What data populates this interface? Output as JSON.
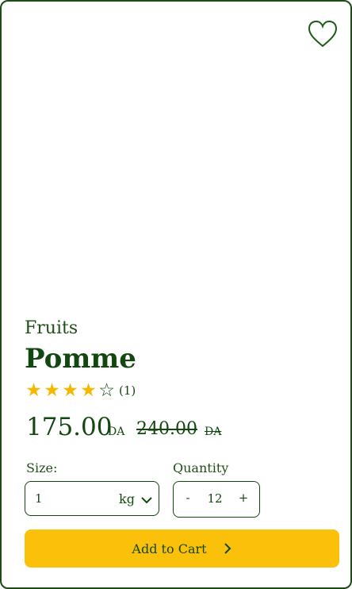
{
  "product": {
    "category": "Fruits",
    "name": "Pomme",
    "rating": {
      "stars": 4,
      "max": 5,
      "count_label": "(1)"
    },
    "price": {
      "current": "175.00",
      "currency": "DA",
      "old": "240.00",
      "old_currency": "DA"
    }
  },
  "icons": {
    "favorite": "heart-outline-icon",
    "unit_dropdown": "chevron-down-icon",
    "cart_arrow": "chevron-right-icon"
  },
  "size": {
    "label": "Size:",
    "value": "1",
    "unit": "kg"
  },
  "quantity": {
    "label": "Quantity",
    "minus": "-",
    "value": "12",
    "plus": "+"
  },
  "cart": {
    "label": "Add to Cart"
  },
  "colors": {
    "brand_green": "#134710",
    "accent_yellow": "#fbc10a",
    "star": "#f5b800"
  }
}
